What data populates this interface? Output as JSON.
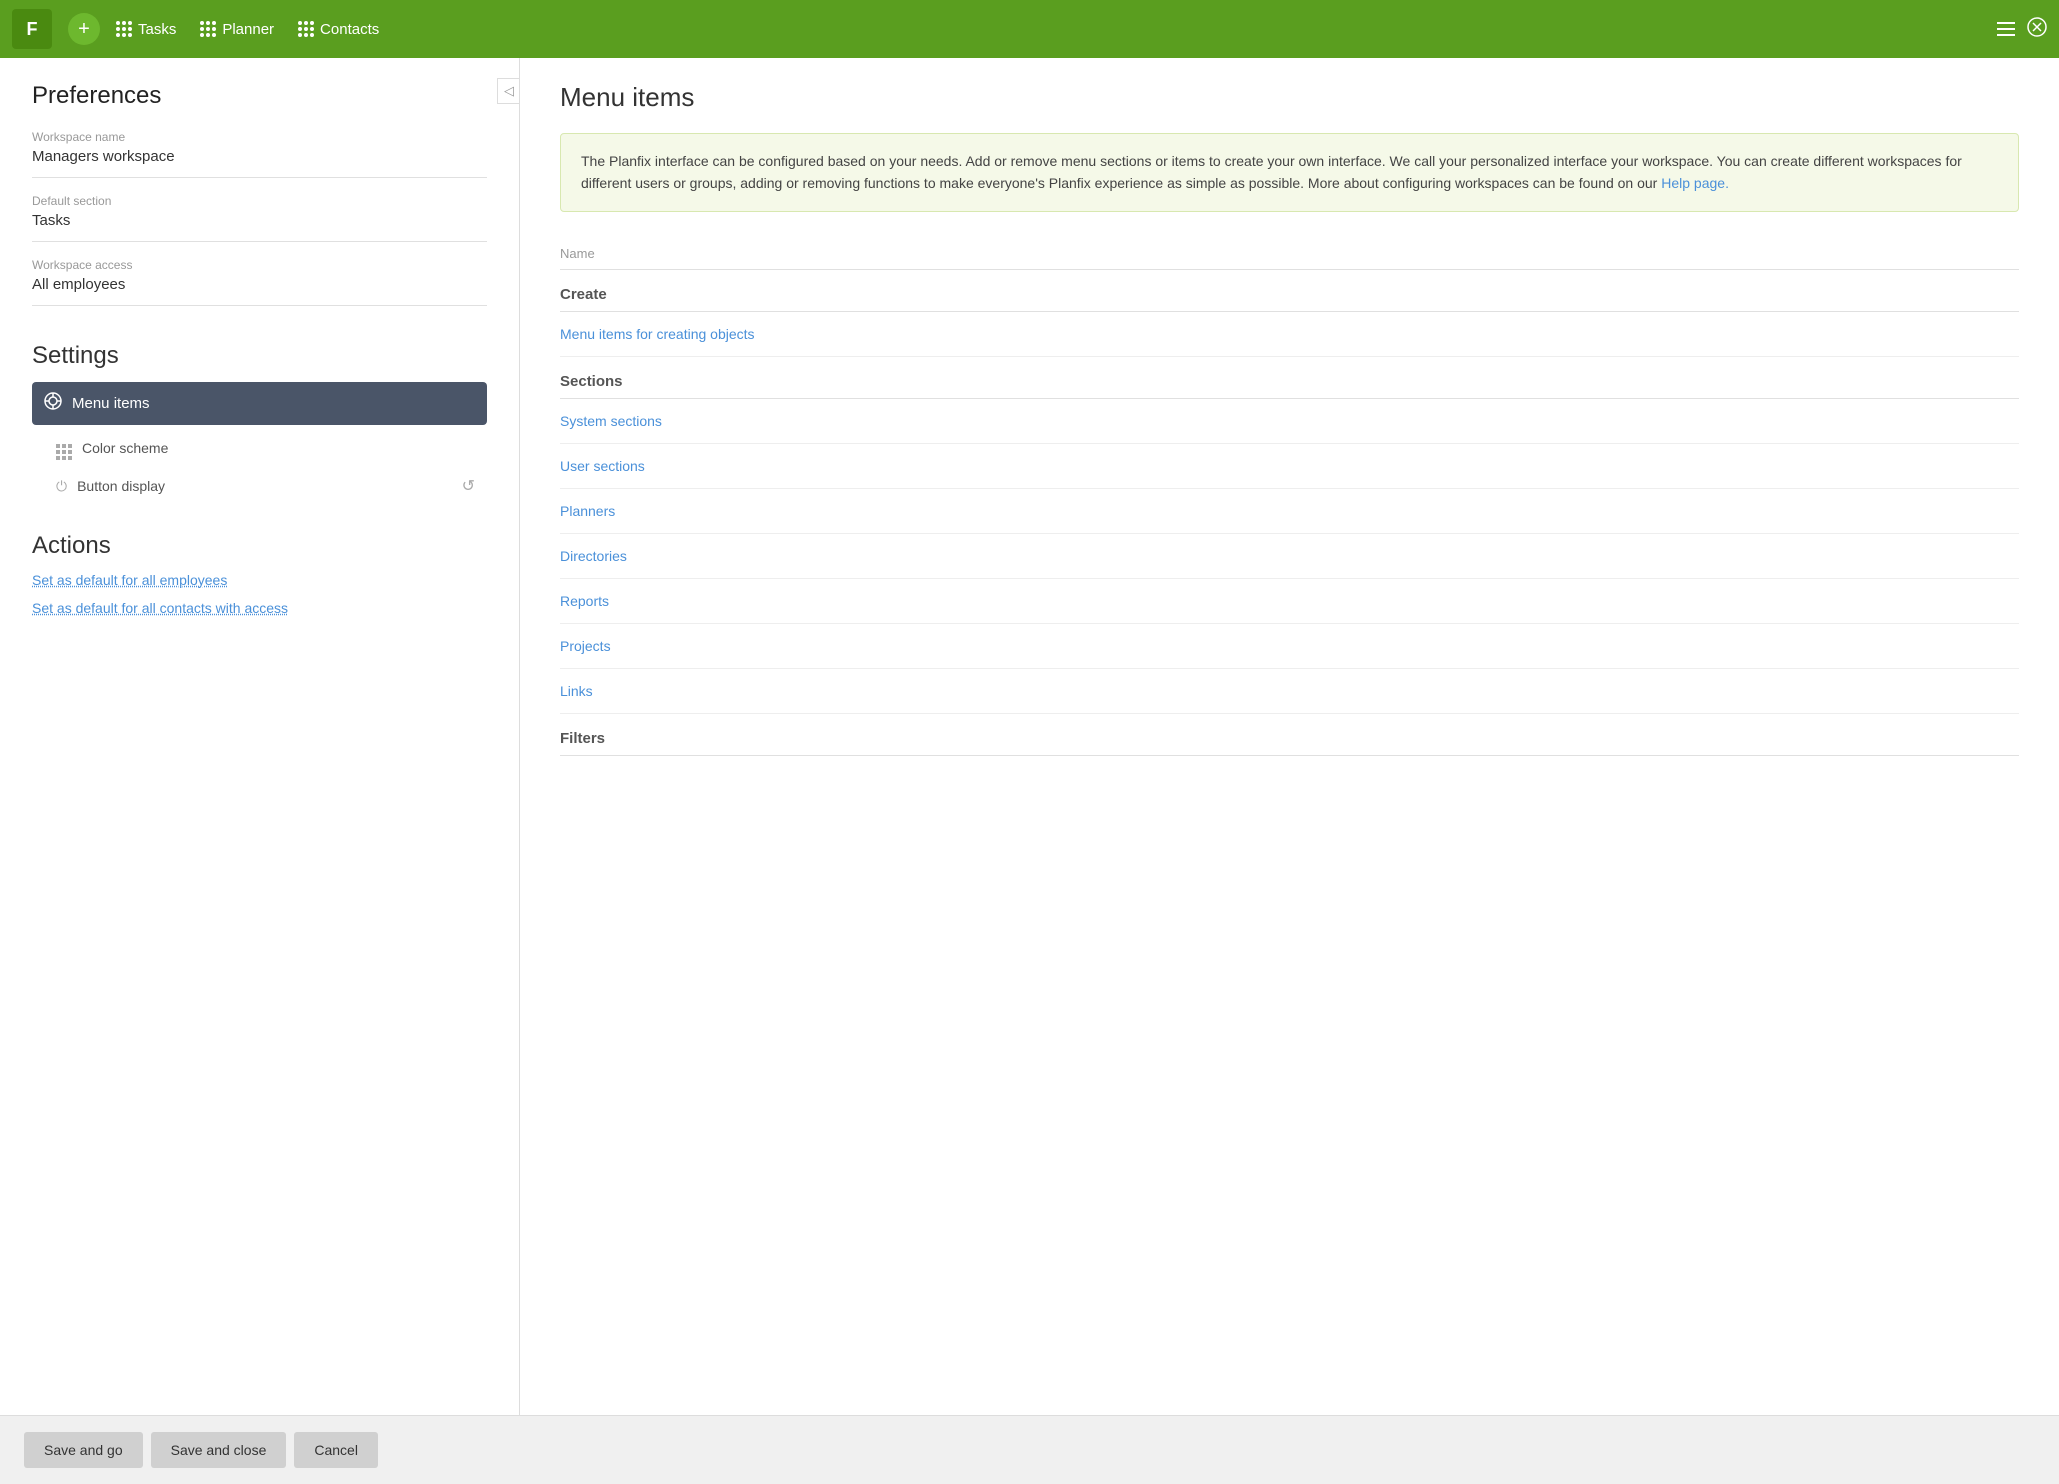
{
  "topnav": {
    "logo_label": "F",
    "add_label": "+",
    "items": [
      {
        "label": "Tasks",
        "id": "tasks"
      },
      {
        "label": "Planner",
        "id": "planner"
      },
      {
        "label": "Contacts",
        "id": "contacts"
      }
    ]
  },
  "left": {
    "preferences_title": "Preferences",
    "collapse_icon": "◁",
    "fields": [
      {
        "label": "Workspace name",
        "value": "Managers workspace"
      },
      {
        "label": "Default section",
        "value": "Tasks"
      },
      {
        "label": "Workspace access",
        "value": "All employees"
      }
    ],
    "settings_title": "Settings",
    "settings_items": [
      {
        "label": "Menu items",
        "active": true,
        "icon": "menu"
      },
      {
        "label": "Color scheme",
        "active": false,
        "icon": "grid"
      },
      {
        "label": "Button display",
        "active": false,
        "icon": "power"
      }
    ],
    "actions_title": "Actions",
    "actions": [
      {
        "label": "Set as default for all employees",
        "id": "default-employees"
      },
      {
        "label": "Set as default for all contacts with access",
        "id": "default-contacts"
      }
    ]
  },
  "right": {
    "title": "Menu items",
    "info_text": "The Planfix interface can be configured based on your needs. Add or remove menu sections or items to create your own interface. We call your personalized interface your workspace. You can create different workspaces for different users or groups, adding or removing functions to make everyone's Planfix experience as simple as possible. More about configuring workspaces can be found on our",
    "info_link": "Help page.",
    "name_header": "Name",
    "group_create": "Create",
    "create_item": "Menu items for creating objects",
    "group_sections": "Sections",
    "sections": [
      "System sections",
      "User sections",
      "Planners",
      "Directories",
      "Reports",
      "Projects",
      "Links"
    ],
    "group_filters": "Filters"
  },
  "footer": {
    "save_go": "Save and go",
    "save_close": "Save and close",
    "cancel": "Cancel"
  }
}
